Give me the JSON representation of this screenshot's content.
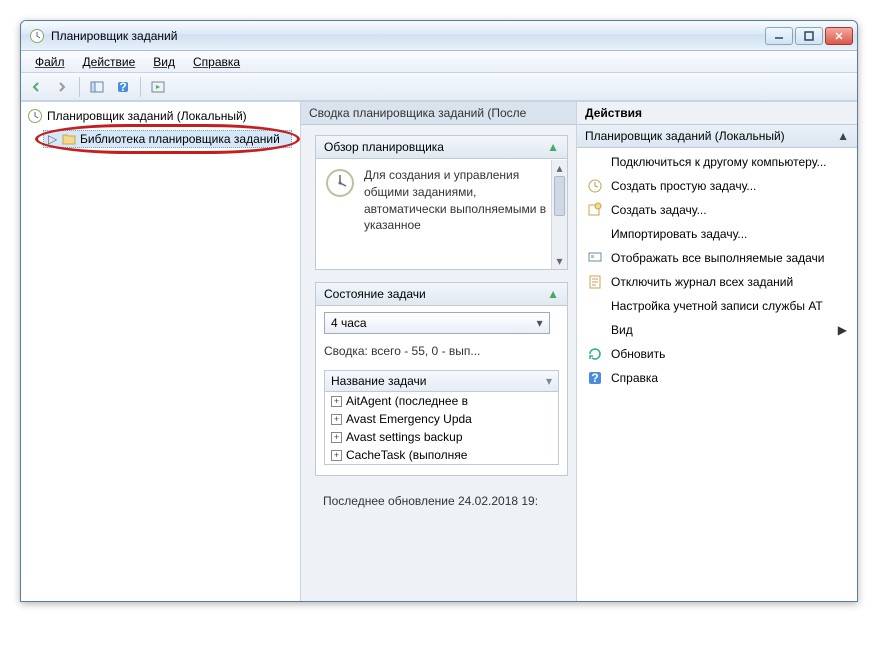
{
  "titlebar": {
    "title": "Планировщик заданий"
  },
  "menubar": {
    "file": "Файл",
    "action": "Действие",
    "view": "Вид",
    "help": "Справка"
  },
  "tree": {
    "root": "Планировщик заданий (Локальный)",
    "library": "Библиотека планировщика заданий"
  },
  "middle": {
    "header": "Сводка планировщика заданий (После",
    "overview": {
      "title": "Обзор планировщика",
      "text": "Для создания и управления общими заданиями, автоматически выполняемыми в указанное"
    },
    "status": {
      "title": "Состояние задачи",
      "combo_value": "4 часа",
      "summary": "Сводка: всего - 55, 0 - вып...",
      "list_header": "Название задачи",
      "tasks": [
        "AitAgent (последнее в",
        "Avast Emergency Upda",
        "Avast settings backup",
        "CacheTask (выполняе"
      ]
    },
    "footer": "Последнее обновление 24.02.2018 19:"
  },
  "actions": {
    "title": "Действия",
    "subtitle": "Планировщик заданий (Локальный)",
    "items": [
      {
        "label": "Подключиться к другому компьютеру...",
        "icon": "blank"
      },
      {
        "label": "Создать простую задачу...",
        "icon": "basic-task"
      },
      {
        "label": "Создать задачу...",
        "icon": "create-task"
      },
      {
        "label": "Импортировать задачу...",
        "icon": "blank"
      },
      {
        "label": "Отображать все выполняемые задачи",
        "icon": "display"
      },
      {
        "label": "Отключить журнал всех заданий",
        "icon": "history"
      },
      {
        "label": "Настройка учетной записи службы AT",
        "icon": "blank"
      },
      {
        "label": "Вид",
        "icon": "blank",
        "arrow": true
      },
      {
        "label": "Обновить",
        "icon": "refresh"
      },
      {
        "label": "Справка",
        "icon": "help"
      }
    ]
  }
}
